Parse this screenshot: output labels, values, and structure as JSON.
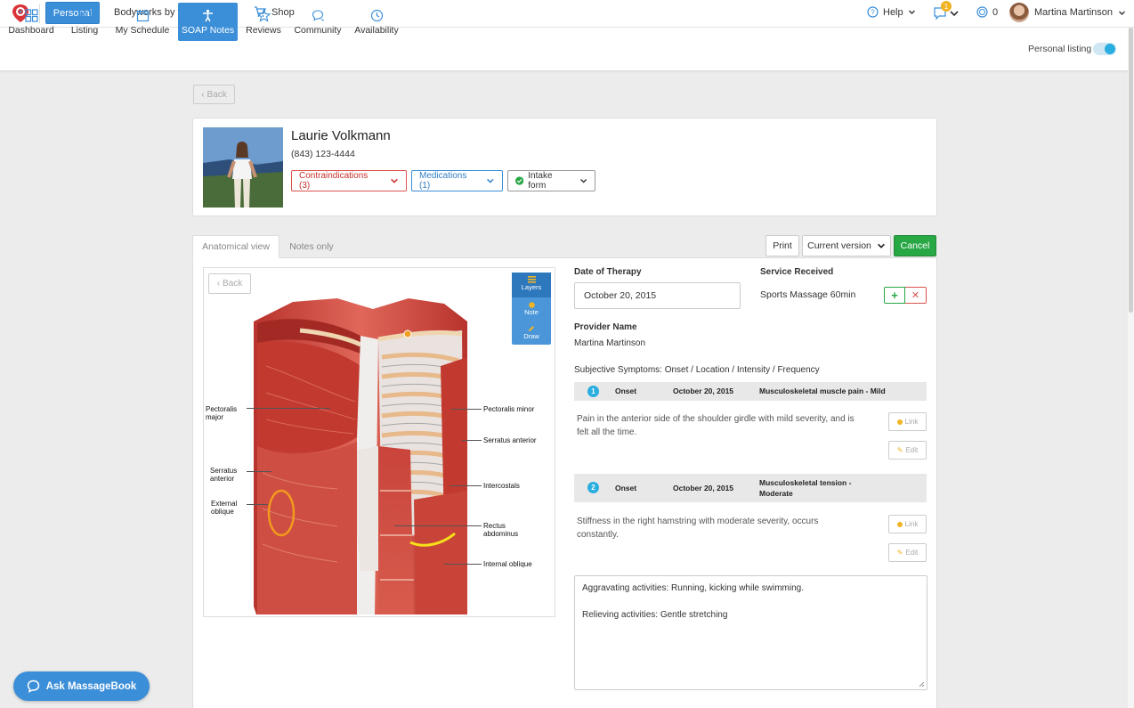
{
  "topbar": {
    "account_type": "Personal",
    "business": "Bodyworks by the Bay",
    "shop": "Shop",
    "help": "Help",
    "notifications_count": "1",
    "points": "0",
    "user_name": "Martina Martinson"
  },
  "nav": {
    "items": [
      {
        "label": "Dashboard",
        "icon": "grid-icon"
      },
      {
        "label": "Listing",
        "icon": "profile-icon"
      },
      {
        "label": "My Schedule",
        "icon": "calendar-icon"
      },
      {
        "label": "SOAP Notes",
        "icon": "body-icon"
      },
      {
        "label": "Reviews",
        "icon": "star-icon"
      },
      {
        "label": "Community",
        "icon": "chat-icon"
      },
      {
        "label": "Availability",
        "icon": "clock-icon"
      }
    ],
    "active": "SOAP Notes",
    "personal_listing": "Personal listing",
    "personal_listing_on": true
  },
  "back_label": "Back",
  "client": {
    "name": "Laurie Volkmann",
    "phone": "(843) 123-4444",
    "contraindications": "Contraindications (3)",
    "medications": "Medications (1)",
    "intake": "Intake form"
  },
  "tabs": {
    "anatomical": "Anatomical view",
    "notes_only": "Notes only"
  },
  "actions": {
    "print": "Print",
    "version": "Current version",
    "cancel": "Cancel"
  },
  "anatomy": {
    "back": "Back",
    "tools": {
      "layers": "Layers",
      "note": "Note",
      "draw": "Draw"
    },
    "labels": {
      "pectoralis_major": "Pectoralis major",
      "serratus_anterior_left": "Serratus anterior",
      "external_oblique": "External oblique",
      "pectoralis_minor": "Pectoralis minor",
      "serratus_anterior_right": "Serratus anterior",
      "intercostals": "Intercostals",
      "rectus_abdominus": "Rectus abdominus",
      "internal_oblique": "Internal oblique"
    }
  },
  "form": {
    "date_label": "Date of Therapy",
    "date_value": "October 20, 2015",
    "service_label": "Service Received",
    "service_value": "Sports Massage 60min",
    "provider_label": "Provider Name",
    "provider_value": "Martina Martinson",
    "subjective_label": "Subjective Symptoms: Onset / Location / Intensity / Frequency",
    "symptoms": [
      {
        "num": "1",
        "onset": "Onset",
        "date": "October 20, 2015",
        "type": "Musculoskeletal muscle pain - Mild",
        "desc": "Pain in the anterior side of the shoulder girdle with mild severity, and is felt all the time.",
        "link": "Link",
        "edit": "Edit"
      },
      {
        "num": "2",
        "onset": "Onset",
        "date": "October 20, 2015",
        "type": "Musculoskeletal tension - Moderate",
        "desc": "Stiffness in the right hamstring with moderate severity, occurs constantly.",
        "link": "Link",
        "edit": "Edit"
      }
    ],
    "aggravating": "Aggravating activities: Running, kicking while swimming.",
    "relieving": "Relieving activities: Gentle stretching"
  },
  "ask": "Ask MassageBook",
  "colors": {
    "primary": "#3b8ed8",
    "success": "#28a745",
    "danger": "#d9534f",
    "accent_teal": "#29aedf",
    "warning": "#f0b323"
  }
}
